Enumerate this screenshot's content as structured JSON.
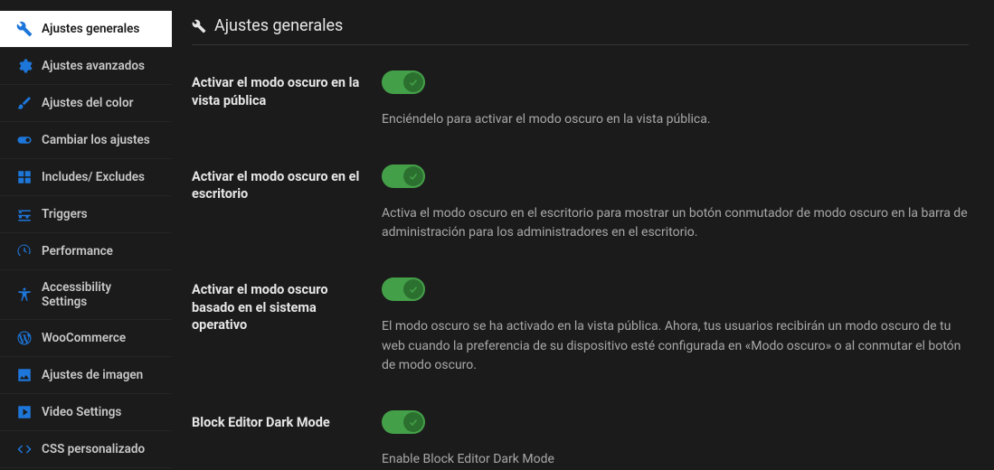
{
  "page": {
    "title": "Ajustes generales"
  },
  "sidebar": {
    "items": [
      {
        "label": "Ajustes generales"
      },
      {
        "label": "Ajustes avanzados"
      },
      {
        "label": "Ajustes del color"
      },
      {
        "label": "Cambiar los ajustes"
      },
      {
        "label": "Includes/ Excludes"
      },
      {
        "label": "Triggers"
      },
      {
        "label": "Performance"
      },
      {
        "label": "Accessibility Settings"
      },
      {
        "label": "WooCommerce"
      },
      {
        "label": "Ajustes de imagen"
      },
      {
        "label": "Video Settings"
      },
      {
        "label": "CSS personalizado"
      }
    ]
  },
  "settings": [
    {
      "label": "Activar el modo oscuro en la vista pública",
      "desc": "Enciéndelo para activar el modo oscuro en la vista pública.",
      "on": true
    },
    {
      "label": "Activar el modo oscuro en el escritorio",
      "desc": "Activa el modo oscuro en el escritorio para mostrar un botón conmutador de modo oscuro en la barra de administración para los administradores en el escritorio.",
      "on": true
    },
    {
      "label": "Activar el modo oscuro basado en el sistema operativo",
      "desc": "El modo oscuro se ha activado en la vista pública. Ahora, tus usuarios recibirán un modo oscuro de tu web cuando la preferencia de su dispositivo esté configurada en «Modo oscuro» o al conmutar el botón de modo oscuro.",
      "on": true
    },
    {
      "label": "Block Editor Dark Mode",
      "desc": "Enable Block Editor Dark Mode",
      "on": true
    }
  ]
}
